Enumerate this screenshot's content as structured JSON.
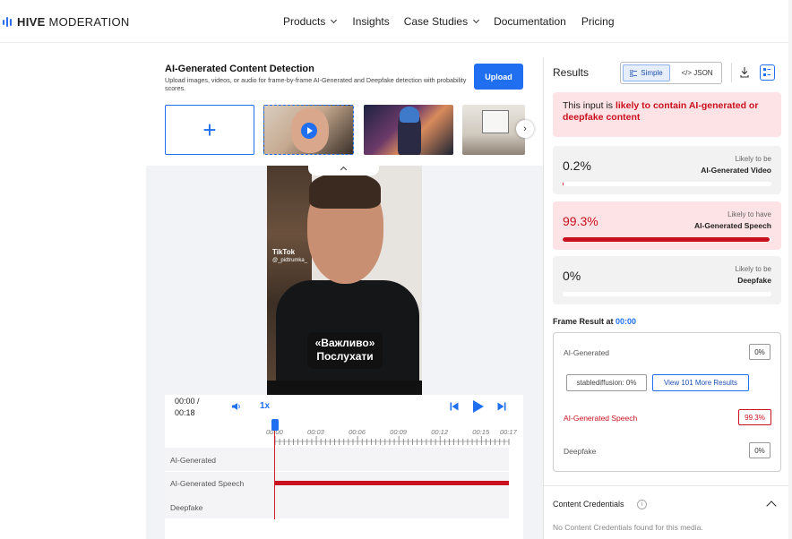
{
  "brand": {
    "name_bold": "HIVE",
    "name_rest": "MODERATION"
  },
  "nav": {
    "items": [
      {
        "label": "Products",
        "dropdown": true
      },
      {
        "label": "Insights",
        "dropdown": false
      },
      {
        "label": "Case Studies",
        "dropdown": true
      },
      {
        "label": "Documentation",
        "dropdown": false
      },
      {
        "label": "Pricing",
        "dropdown": false
      }
    ]
  },
  "detector": {
    "title": "AI-Generated Content Detection",
    "description": "Upload images, videos, or audio for frame-by-frame AI-Generated and Deepfake detection with probability scores.",
    "upload_label": "Upload",
    "add_symbol": "+"
  },
  "video": {
    "tiktok_label": "TikTok",
    "tiktok_user": "@_pidtrumka_",
    "caption_line1": "«Важливо»",
    "caption_line2": "Послухати"
  },
  "player": {
    "time_current": "00:00 /",
    "time_total": "00:18",
    "speed": "1x",
    "ticks": [
      "00:00",
      "00:03",
      "00:06",
      "00:09",
      "00:12",
      "00:15",
      "00:17"
    ],
    "tracks": [
      "AI-Generated",
      "AI-Generated Speech",
      "Deepfake"
    ]
  },
  "results": {
    "title": "Results",
    "simple_label": "Simple",
    "json_label": "</> JSON",
    "alert_prefix": "This input is ",
    "alert_highlight": "likely to contain AI-generated or deepfake content",
    "cards": [
      {
        "pct": "0.2%",
        "likely": "Likely to be",
        "class": "AI-Generated Video",
        "value": 0.002,
        "highlight": false
      },
      {
        "pct": "99.3%",
        "likely": "Likely to have",
        "class": "AI-Generated Speech",
        "value": 0.993,
        "highlight": true
      },
      {
        "pct": "0%",
        "likely": "Likely to be",
        "class": "Deepfake",
        "value": 0.0,
        "highlight": false
      }
    ],
    "frame_result_label": "Frame Result at ",
    "frame_result_time": "00:00",
    "frame": {
      "ai_generated_label": "AI-Generated",
      "ai_generated_value": "0%",
      "stablediffusion_chip": "stablediffusion: 0%",
      "more_results": "View 101 More Results",
      "speech_label": "AI-Generated Speech",
      "speech_value": "99.3%",
      "deepfake_label": "Deepfake",
      "deepfake_value": "0%"
    },
    "content_credentials_title": "Content Credentials",
    "content_credentials_info": "i",
    "content_credentials_text": "No Content Credentials found for this media."
  },
  "colors": {
    "accent": "#1f6ff0",
    "danger": "#c8101e",
    "alert_bg": "#fde3e5"
  }
}
